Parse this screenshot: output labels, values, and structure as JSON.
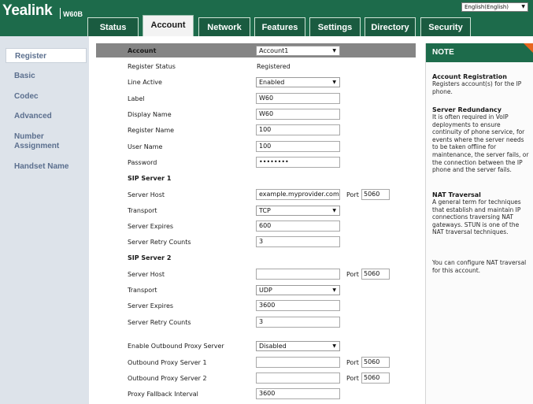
{
  "header": {
    "logo": "Yealink",
    "model": "W60B",
    "language": "English(English)",
    "tabs": [
      "Status",
      "Account",
      "Network",
      "Features",
      "Settings",
      "Directory",
      "Security"
    ],
    "active_tab": "Account"
  },
  "sidebar": {
    "items": [
      "Register",
      "Basic",
      "Codec",
      "Advanced",
      "Number Assignment",
      "Handset Name"
    ],
    "active": "Register"
  },
  "form": {
    "account_label": "Account",
    "account_value": "Account1",
    "register_status_label": "Register Status",
    "register_status_value": "Registered",
    "line_active_label": "Line Active",
    "line_active_value": "Enabled",
    "label_label": "Label",
    "label_value": "W60",
    "display_name_label": "Display Name",
    "display_name_value": "W60",
    "register_name_label": "Register Name",
    "register_name_value": "100",
    "user_name_label": "User Name",
    "user_name_value": "100",
    "password_label": "Password",
    "password_value": "••••••••",
    "sip1_title": "SIP Server 1",
    "sip1_host_label": "Server Host",
    "sip1_host_value": "example.myprovider.com",
    "sip1_port_label": "Port",
    "sip1_port_value": "5060",
    "sip1_transport_label": "Transport",
    "sip1_transport_value": "TCP",
    "sip1_expires_label": "Server Expires",
    "sip1_expires_value": "600",
    "sip1_retry_label": "Server Retry Counts",
    "sip1_retry_value": "3",
    "sip2_title": "SIP Server 2",
    "sip2_host_label": "Server Host",
    "sip2_host_value": "",
    "sip2_port_label": "Port",
    "sip2_port_value": "5060",
    "sip2_transport_label": "Transport",
    "sip2_transport_value": "UDP",
    "sip2_expires_label": "Server Expires",
    "sip2_expires_value": "3600",
    "sip2_retry_label": "Server Retry Counts",
    "sip2_retry_value": "3",
    "outbound_enable_label": "Enable Outbound Proxy Server",
    "outbound_enable_value": "Disabled",
    "outbound1_label": "Outbound Proxy Server 1",
    "outbound1_value": "",
    "outbound1_port_label": "Port",
    "outbound1_port_value": "5060",
    "outbound2_label": "Outbound Proxy Server 2",
    "outbound2_value": "",
    "outbound2_port_label": "Port",
    "outbound2_port_value": "5060",
    "fallback_label": "Proxy Fallback Interval",
    "fallback_value": "3600"
  },
  "note": {
    "title": "NOTE",
    "sections": [
      {
        "heading": "Account Registration",
        "text": "Registers account(s) for the IP phone."
      },
      {
        "heading": "Server Redundancy",
        "text": "It is often required in VoIP deployments to ensure continuity of phone service, for events where the server needs to be taken offline for maintenance, the server fails, or the connection between the IP phone and the server fails."
      },
      {
        "heading": "NAT Traversal",
        "text": "A general term for techniques that establish and maintain IP connections traversing NAT gateways. STUN is one of the NAT traversal techniques."
      },
      {
        "heading": "",
        "text": "You can configure NAT traversal for this account."
      }
    ]
  },
  "colors": {
    "header_green": "#1d6b4b",
    "tab_dark": "#1a5b40",
    "sidebar_bg": "#dde3ea",
    "nav_text": "#5b6f8e",
    "account_bar": "#858585",
    "note_corner": "#e8661e"
  }
}
